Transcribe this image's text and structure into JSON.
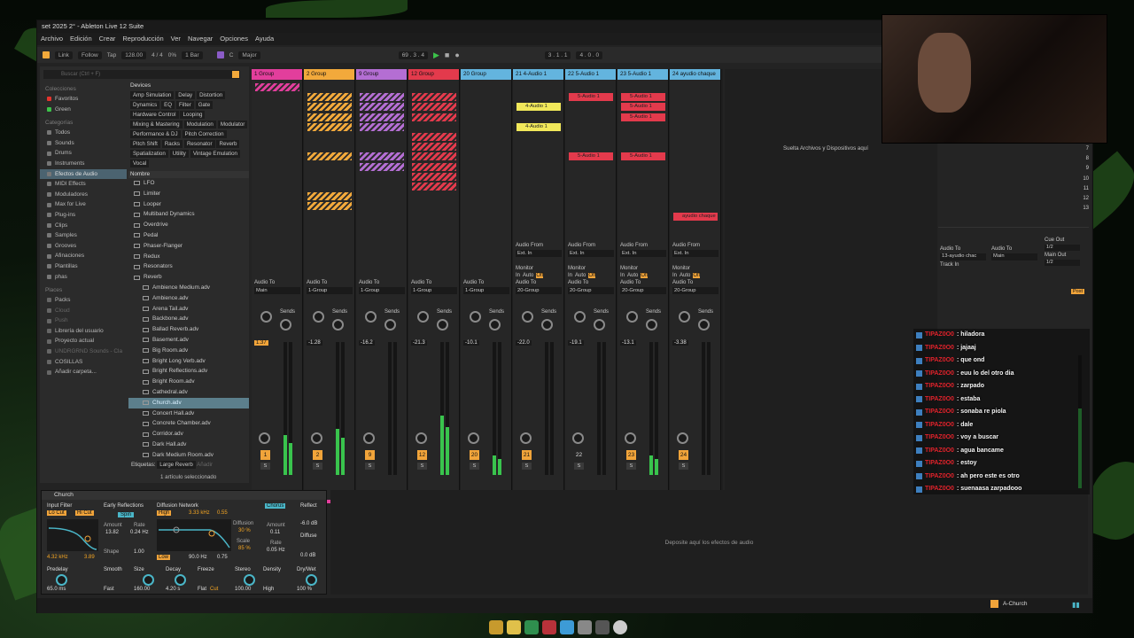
{
  "window": {
    "title": "set 2025 2° - Ableton Live 12 Suite"
  },
  "menu": [
    "Archivo",
    "Edición",
    "Crear",
    "Reproducción",
    "Ver",
    "Navegar",
    "Opciones",
    "Ayuda"
  ],
  "transport": {
    "link": "Link",
    "follow": "Follow",
    "tap": "Tap",
    "tempo": "128.00",
    "sig": "4 / 4",
    "cpu": "0%",
    "quant": "1 Bar",
    "key": "C",
    "scale": "Major",
    "pos": "69 . 3 . 4",
    "loop_start": "3 . 1 . 1",
    "loop_len": "4 . 0 . 0"
  },
  "browser": {
    "search_placeholder": "Buscar (Ctrl + F)",
    "collections_label": "Colecciones",
    "collections": [
      {
        "label": "Favoritos",
        "color": "#e5342d"
      },
      {
        "label": "Green",
        "color": "#3cc24a"
      }
    ],
    "categories_label": "Categorías",
    "categories": [
      "Todos",
      "Sounds",
      "Drums",
      "Instruments",
      "Efectos de Audio",
      "MIDI Effects",
      "Moduladores",
      "Max for Live",
      "Plug-ins",
      "Clips",
      "Samples",
      "Grooves",
      "Afinaciones",
      "Plantillas",
      "phas"
    ],
    "places_label": "Places",
    "places": [
      "Packs",
      "Cloud",
      "Push",
      "Librería del usuario",
      "Proyecto actual",
      "UNDRGRND Sounds - Cla",
      "COSILLAS",
      "Añadir carpeta..."
    ],
    "devices_label": "Devices",
    "device_tags": [
      "Amp Simulation",
      "Delay",
      "Distortion",
      "Dynamics",
      "EQ",
      "Filter",
      "Gate",
      "Hardware Control",
      "Looping",
      "Mixing & Mastering",
      "Modulation",
      "Modulator",
      "Performance & DJ",
      "Pitch Correction",
      "Pitch Shift",
      "Racks",
      "Resonator",
      "Reverb",
      "Spatialization",
      "Utility",
      "Vintage Emulation",
      "Vocal"
    ],
    "name_header": "Nombre",
    "folders": [
      "LFO",
      "Limiter",
      "Looper",
      "Multiband Dynamics",
      "Overdrive",
      "Pedal",
      "Phaser-Flanger",
      "Redux",
      "Resonators",
      "Reverb"
    ],
    "presets": [
      "Ambience Medium.adv",
      "Ambience.adv",
      "Arena Tail.adv",
      "Backbone.adv",
      "Ballad Reverb.adv",
      "Basement.adv",
      "Big Room.adv",
      "Bright Long Verb.adv",
      "Bright Reflections.adv",
      "Bright Room.adv",
      "Cathedral.adv",
      "Church.adv",
      "Concert Hall.adv",
      "Concrete Chamber.adv",
      "Corridor.adv",
      "Dark Hall.adv",
      "Dark Medium Room.adv",
      "Dark Small Room.adv"
    ],
    "tags_label": "Etiquetas:",
    "tags_value": "Large Reverb",
    "tags_add": "Añadir",
    "selection_count": "1 artículo seleccionado"
  },
  "tracks": [
    {
      "name": "1 Group",
      "color": "#e23e9c",
      "audio_to": "Main",
      "vol": "1.37",
      "num": "1"
    },
    {
      "name": "2 Group",
      "color": "#f2a93b",
      "audio_to": "1-Group",
      "vol": "-1.28",
      "num": "2"
    },
    {
      "name": "9 Group",
      "color": "#b46ed3",
      "audio_to": "1-Group",
      "vol": "-16.2",
      "num": "9"
    },
    {
      "name": "12 Group",
      "color": "#e33a4c",
      "audio_to": "1-Group",
      "vol": "-21.3",
      "num": "12"
    },
    {
      "name": "20 Group",
      "color": "#63b4de",
      "audio_to": "1-Group",
      "vol": "-10.1",
      "num": "20"
    },
    {
      "name": "21 4-Audio 1",
      "color": "#63b4de",
      "audio_to": "20-Group",
      "vol": "-22.0",
      "num": "21"
    },
    {
      "name": "22 5-Audio 1",
      "color": "#63b4de",
      "audio_to": "20-Group",
      "vol": "-19.1",
      "num": "22"
    },
    {
      "name": "23 5-Audio 1",
      "color": "#63b4de",
      "audio_to": "20-Group",
      "vol": "-13.1",
      "num": "23"
    },
    {
      "name": "24 ayudio chaque",
      "color": "#63b4de",
      "audio_to": "20-Group",
      "vol": "-3.38",
      "num": "24"
    }
  ],
  "clips": {
    "a4": "4-Audio 1",
    "a5": "5-Audio 1",
    "chaque": "ayudio chaque"
  },
  "mixer": {
    "audio_from": "Audio From",
    "ext_in": "Ext. In",
    "monitor": "Monitor",
    "in": "In",
    "auto": "Auto",
    "off": "Off",
    "audio_to": "Audio To",
    "sends": "Sends",
    "s": "S"
  },
  "right": {
    "drop": "Suelta Archivos y Dispositivos aquí",
    "cue_out": "Cue Out",
    "cue_val": "1/2",
    "main_out": "Main Out",
    "main_val": "1/2",
    "r_audio_to": "13-ayudio chac",
    "main": "Main",
    "track_in": "Track In",
    "post": "Post",
    "scene_nums": [
      "7",
      "8",
      "9",
      "10",
      "11",
      "12",
      "13"
    ]
  },
  "device": {
    "name": "Church",
    "input_filter": "Input Filter",
    "lo_cut": "Lo Cut",
    "hi_cut": "Hi Cut",
    "freq": "4.32 kHz",
    "width": "3.89",
    "early": "Early Reflections",
    "spin": "Spin",
    "amount": "Amount",
    "amount_v": "13.82",
    "rate": "Rate",
    "rate_v": "0.24 Hz",
    "shape": "Shape",
    "shape_v": "1.00",
    "diffusion": "Diffusion Network",
    "high": "High",
    "hi_freq": "3.33 kHz",
    "hi_q": "0.55",
    "low": "Low",
    "lo_freq": "90.0 Hz",
    "lo_q": "0.75",
    "diff": "Diffusion",
    "diff_v": "30 %",
    "scale": "Scale",
    "scale_v": "85 %",
    "chorus": "Chorus",
    "ch_amount": "0.11",
    "ch_rate": "0.05 Hz",
    "reflect": "Reflect",
    "reflect_v": "-6.0 dB",
    "diffuse": "Diffuse",
    "diffuse_v": "0.0 dB",
    "predelay": "Predelay",
    "predelay_v": "65.0 ms",
    "smooth": "Smooth",
    "smooth_v": "Fast",
    "size": "Size",
    "size_v": "160.00",
    "decay": "Decay",
    "decay_v": "4.20 s",
    "freeze": "Freeze",
    "flat": "Flat",
    "cut": "Cut",
    "stereo": "Stereo",
    "stereo_v": "100.00",
    "density": "Density",
    "density_v": "High",
    "drywet": "Dry/Wet",
    "drywet_v": "100 %"
  },
  "dropzone": "Deposite aquí los efectos de audio",
  "statusbar": {
    "device": "A-Church"
  },
  "chat": [
    {
      "user": "TIPAZ0O0",
      "text": ": hiladora"
    },
    {
      "user": "TIPAZ0O0",
      "text": ": jajaaj"
    },
    {
      "user": "TIPAZ0O0",
      "text": ": que ond"
    },
    {
      "user": "TIPAZ0O0",
      "text": ": euu lo del otro dia"
    },
    {
      "user": "TIPAZ0O0",
      "text": ": zarpado"
    },
    {
      "user": "TIPAZ0O0",
      "text": ": estaba"
    },
    {
      "user": "TIPAZ0O0",
      "text": ": sonaba re piola"
    },
    {
      "user": "TIPAZ0O0",
      "text": ": dale"
    },
    {
      "user": "TIPAZ0O0",
      "text": ": voy a buscar"
    },
    {
      "user": "TIPAZ0O0",
      "text": ": agua bancame"
    },
    {
      "user": "TIPAZ0O0",
      "text": ": estoy"
    },
    {
      "user": "TIPAZ0O0",
      "text": ": ah pero este es otro"
    },
    {
      "user": "TIPAZ0O0",
      "text": ": suenaasa zarpadooo"
    }
  ]
}
